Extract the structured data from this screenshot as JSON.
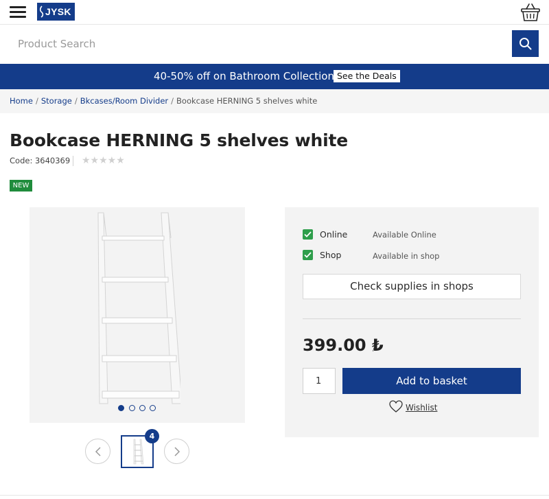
{
  "header": {
    "logo_text": "JYSK",
    "menu_icon": "hamburger-menu-icon",
    "basket_icon": "basket-icon"
  },
  "search": {
    "placeholder": "Product Search",
    "button_icon": "search-icon"
  },
  "promo": {
    "text": "40-50% off on Bathroom Collection",
    "link_label": "See the Deals"
  },
  "breadcrumb": {
    "items": [
      "Home",
      "Storage",
      "Bkcases/Room Divider"
    ],
    "current": "Bookcase HERNING 5 shelves white",
    "separator": "/"
  },
  "product": {
    "title": "Bookcase HERNING 5 shelves white",
    "code": "Code: 3640369",
    "rating_stars": "★★★★★",
    "rating_value": 0,
    "badge": "NEW"
  },
  "gallery": {
    "image_count": "4",
    "active_dot": 0,
    "dot_count": 4,
    "prev_icon": "chevron-left-icon",
    "next_icon": "chevron-right-icon"
  },
  "availability": {
    "rows": [
      {
        "label": "Online",
        "status": "Available Online",
        "checked": true
      },
      {
        "label": "Shop",
        "status": "Available in shop",
        "checked": true
      }
    ],
    "check_button": "Check supplies in shops"
  },
  "purchase": {
    "price": "399.00 ₺",
    "price_suffix": "/",
    "quantity": "1",
    "add_button": "Add to basket",
    "wishlist_label": "Wishlist",
    "wishlist_icon": "heart-icon"
  },
  "colors": {
    "brand_blue": "#143c8a",
    "new_badge_green": "#1f8c3c",
    "check_green": "#2e9e4b",
    "panel_bg": "#f3f3f3"
  }
}
